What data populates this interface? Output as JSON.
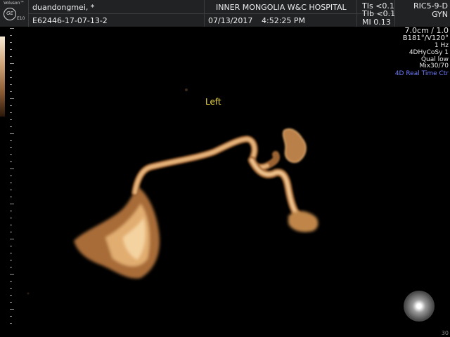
{
  "header": {
    "logo_brand": "Voluson™",
    "logo_model": "E10",
    "logo_mark": "GE",
    "patient_name": "duandongmei,   *",
    "patient_id": "E62446-17-07-13-2",
    "hospital": "INNER MONGOLIA W&C HOSPITAL",
    "date": "07/13/2017",
    "time": "4:52:25 PM",
    "tis": "TIs <0.1",
    "tib": "TIb <0.1",
    "mi": "MI 0.13",
    "probe": "RIC5-9-D",
    "preset": "GYN"
  },
  "params": {
    "depth": "7.0cm / 1.0",
    "angles": "B181°/V120°",
    "rate": "1 Hz",
    "mode": "4DHyCoSy 1",
    "quality": "Qual low",
    "mix": "Mix30/70",
    "realtime": "4D Real Time Ctr"
  },
  "image": {
    "annotation": "Left",
    "frame": "30"
  },
  "colors": {
    "background": "#000000",
    "header_bg": "#202224",
    "annotation": "#f0dc3c",
    "realtime_text": "#6f7dff",
    "render_tint": "#e0aa6a"
  },
  "icons": [
    "ge-logo-icon",
    "navigation-orb-icon"
  ]
}
